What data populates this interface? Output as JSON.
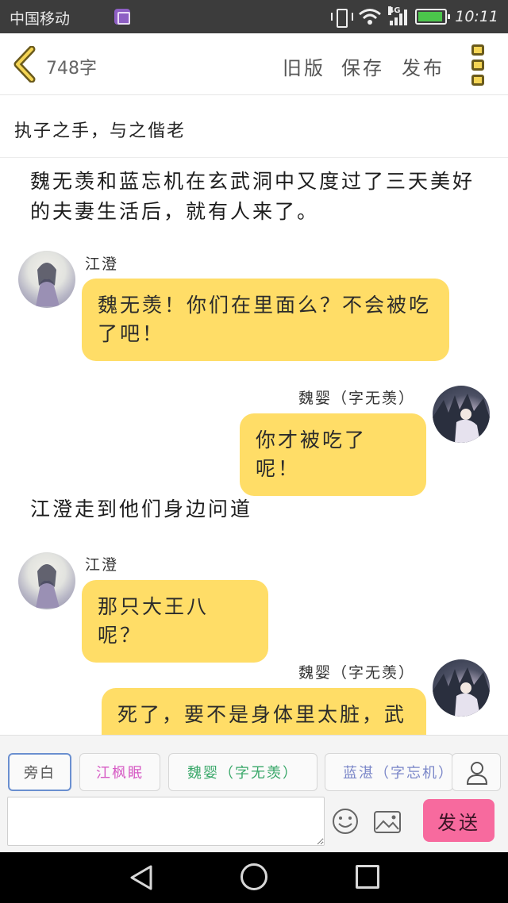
{
  "status_bar": {
    "carrier": "中国移动",
    "network": "4G",
    "time": "10:11"
  },
  "header": {
    "word_count": "748字",
    "old_version": "旧版",
    "save": "保存",
    "publish": "发布"
  },
  "story": {
    "title": "执子之手，与之偕老"
  },
  "messages": {
    "narration_1_line1": "魏无羡和蓝忘机在玄武洞中又度过了三天美好",
    "narration_1_line2": "的夫妻生活后，就有人来了。",
    "m1_speaker": "江澄",
    "m1_line1": "魏无羡！你们在里面么？不会被吃",
    "m1_line2": "了吧！",
    "m2_speaker": "魏婴（字无羡）",
    "m2_text": "你才被吃了呢！",
    "narration_2": "江澄走到他们身边问道",
    "m3_speaker": "江澄",
    "m3_text": "那只大王八呢？",
    "m4_speaker": "魏婴（字无羡）",
    "m4_text": "死了，要不是身体里太脏，武"
  },
  "roles": {
    "narration": "旁白",
    "r1": "江枫眠",
    "r2": "魏婴（字无羡）",
    "r3": "蓝湛（字忘机）"
  },
  "composer": {
    "input_value": "",
    "send": "发送"
  },
  "colors": {
    "bubble": "#ffdd67",
    "send": "#f76a9e",
    "accent_icon": "#f5d554"
  },
  "icons": [
    "back-chevron-icon",
    "menu-icon",
    "add-role-icon",
    "emoji-icon",
    "image-icon",
    "nav-back-icon",
    "nav-home-icon",
    "nav-recent-icon"
  ]
}
